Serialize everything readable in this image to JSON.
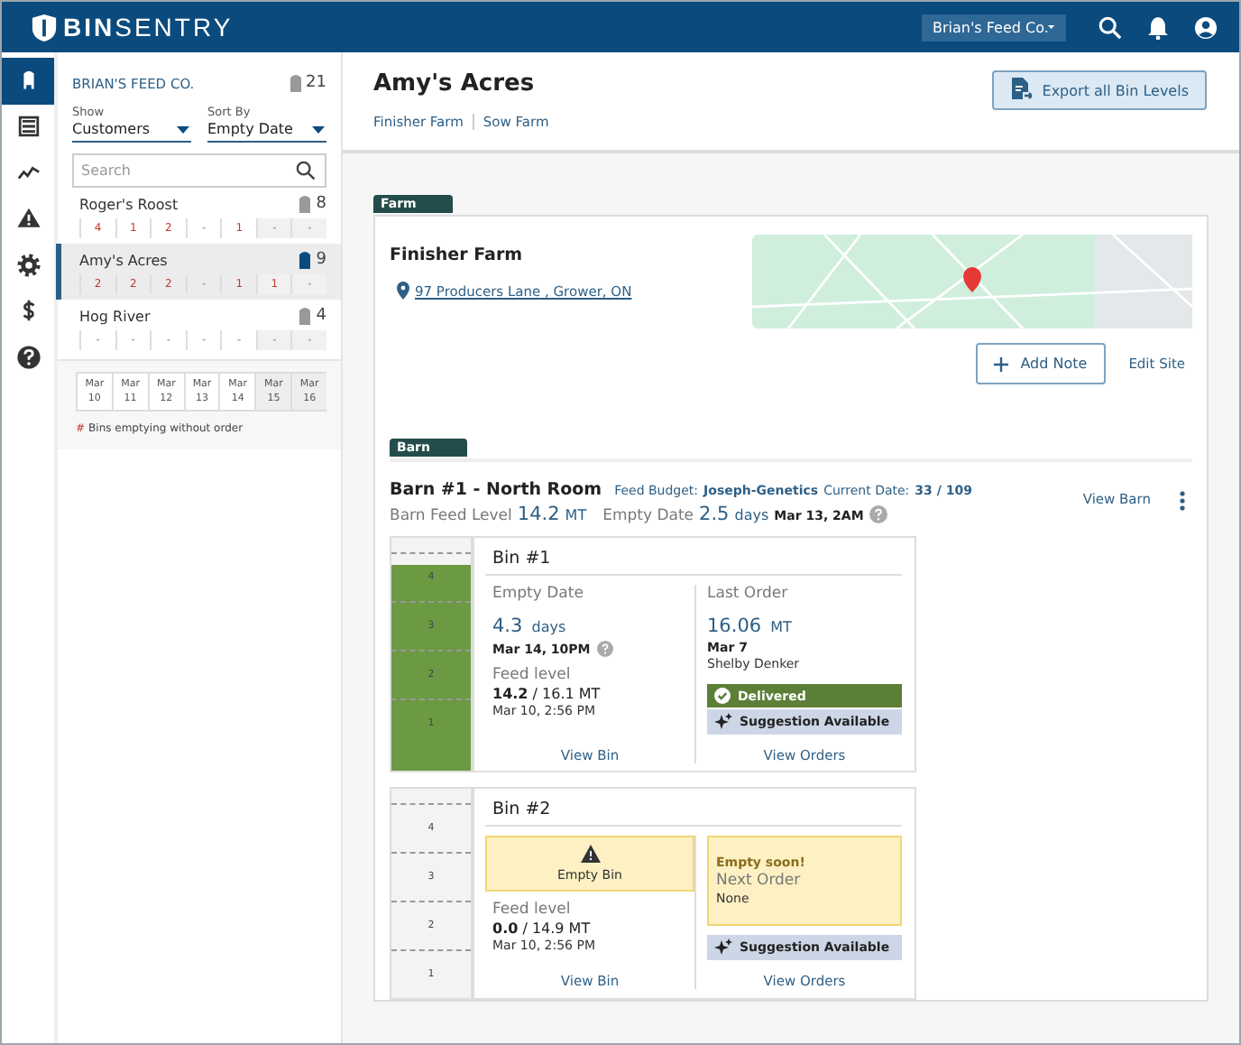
{
  "header": {
    "logo": "**BIN**SENTRY",
    "company_select": "Brian's Feed Co."
  },
  "nav_rail": [
    {
      "kind": "bin",
      "selected": true
    },
    {
      "kind": "list",
      "selected": false
    },
    {
      "kind": "chart",
      "selected": false
    },
    {
      "kind": "alert",
      "selected": false
    },
    {
      "kind": "gear",
      "selected": false
    },
    {
      "kind": "dollar",
      "selected": false
    },
    {
      "kind": "help",
      "selected": false
    }
  ],
  "customer_panel": {
    "company": "BRIAN'S FEED CO.",
    "bin_count": "21",
    "show": {
      "label": "Show",
      "value": "Customers"
    },
    "sort": {
      "label": "Sort By",
      "value": "Empty Date"
    },
    "search": {
      "placeholder": "Search"
    },
    "customers": [
      {
        "name": "Roger's Roost",
        "count": "8",
        "selected": false,
        "cells": [
          {
            "value": "4",
            "alert": true
          },
          {
            "value": "1",
            "alert": true
          },
          {
            "value": "2",
            "alert": true
          },
          {
            "value": "-",
            "alert": false
          },
          {
            "value": "1",
            "alert": true
          },
          {
            "value": "-",
            "alert": false
          },
          {
            "value": "-",
            "alert": false
          }
        ]
      },
      {
        "name": "Amy's Acres",
        "count": "9",
        "selected": true,
        "cells": [
          {
            "value": "2",
            "alert": true
          },
          {
            "value": "2",
            "alert": true
          },
          {
            "value": "2",
            "alert": true
          },
          {
            "value": "-",
            "alert": false
          },
          {
            "value": "1",
            "alert": true
          },
          {
            "value": "1",
            "alert": true
          },
          {
            "value": "-",
            "alert": false
          }
        ]
      },
      {
        "name": "Hog River",
        "count": "4",
        "selected": false,
        "cells": [
          {
            "value": "-",
            "alert": false
          },
          {
            "value": "-",
            "alert": false
          },
          {
            "value": "-",
            "alert": false
          },
          {
            "value": "-",
            "alert": false
          },
          {
            "value": "-",
            "alert": false
          },
          {
            "value": "-",
            "alert": false
          },
          {
            "value": "-",
            "alert": false
          }
        ]
      }
    ],
    "dates": [
      {
        "month": "Mar",
        "day": "10",
        "weekend": false
      },
      {
        "month": "Mar",
        "day": "11",
        "weekend": false
      },
      {
        "month": "Mar",
        "day": "12",
        "weekend": false
      },
      {
        "month": "Mar",
        "day": "13",
        "weekend": false
      },
      {
        "month": "Mar",
        "day": "14",
        "weekend": false
      },
      {
        "month": "Mar",
        "day": "15",
        "weekend": true
      },
      {
        "month": "Mar",
        "day": "16",
        "weekend": true
      }
    ],
    "legend_symbol": "#",
    "legend_text": "Bins emptying without order"
  },
  "page": {
    "title": "Amy's Acres",
    "farm_links": [
      "Finisher Farm",
      "Sow Farm"
    ],
    "export_button": "Export all Bin Levels"
  },
  "farm": {
    "tag": "Farm",
    "name": "Finisher Farm",
    "address": "97 Producers Lane , Grower, ON",
    "add_note": "Add Note",
    "edit_site": "Edit Site"
  },
  "barn": {
    "tag": "Barn",
    "name": "Barn #1 - North Room",
    "feed_budget_label": "Feed Budget:",
    "feed_budget": "Joseph-Genetics",
    "current_date_label": "Current Date:",
    "current_date": "33 / 109",
    "feed_level_label": "Barn Feed Level",
    "feed_level": "14.2",
    "feed_level_unit": "MT",
    "empty_label": "Empty Date",
    "empty_value": "2.5",
    "empty_unit": "days",
    "empty_date": "Mar 13, 2AM",
    "view_barn": "View Barn"
  },
  "bins": [
    {
      "kind": "normal",
      "name": "Bin #1",
      "level": 0.88,
      "marks": [
        "4",
        "3",
        "2",
        "1"
      ],
      "empty_label": "Empty Date",
      "empty_days": "4.3",
      "empty_unit": "days",
      "empty_date": "Mar 14, 10PM",
      "feed_label": "Feed level",
      "feed_current": "14.2",
      "feed_total": "/ 16.1 MT",
      "feed_time": "Mar 10, 2:56 PM",
      "order": {
        "kind": "last",
        "label": "Last Order",
        "amount": "16.06",
        "unit": "MT",
        "date": "Mar 7",
        "person": "Shelby Denker",
        "status": "Delivered"
      },
      "suggestion": "Suggestion Available",
      "view_bin": "View Bin",
      "view_orders": "View Orders"
    },
    {
      "kind": "empty",
      "name": "Bin #2",
      "level": 0,
      "marks": [
        "4",
        "3",
        "2",
        "1"
      ],
      "alert": "Empty Bin",
      "feed_label": "Feed level",
      "feed_current": "0.0",
      "feed_total": "/ 14.9 MT",
      "feed_time": "Mar 10, 2:56 PM",
      "order": {
        "kind": "next",
        "warning": "Empty soon!",
        "label": "Next Order",
        "value": "None"
      },
      "suggestion": "Suggestion Available",
      "view_bin": "View Bin",
      "view_orders": "View Orders"
    }
  ]
}
